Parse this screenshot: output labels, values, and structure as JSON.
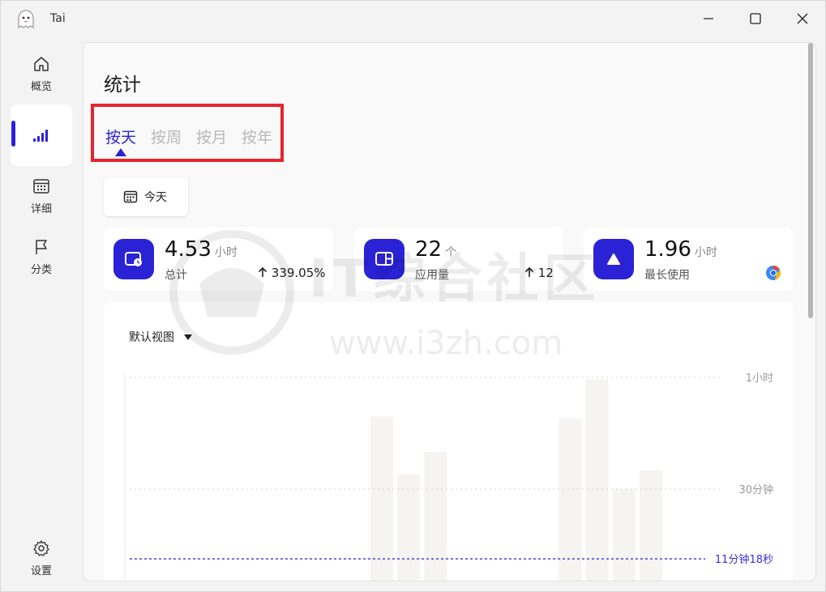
{
  "window": {
    "title": "Tai"
  },
  "sidebar": {
    "items": [
      {
        "label": "概览",
        "icon": "home-icon"
      },
      {
        "label": "",
        "icon": "signal-bars-icon"
      },
      {
        "label": "详细",
        "icon": "calendar-grid-icon"
      },
      {
        "label": "分类",
        "icon": "flag-icon"
      },
      {
        "label": "设置",
        "icon": "gear-icon"
      }
    ]
  },
  "main": {
    "title": "统计",
    "tabs": [
      {
        "label": "按天",
        "active": true
      },
      {
        "label": "按周",
        "active": false
      },
      {
        "label": "按月",
        "active": false
      },
      {
        "label": "按年",
        "active": false
      }
    ],
    "date_button": {
      "label": "今天",
      "icon": "calendar-icon"
    },
    "cards": [
      {
        "value": "4.53",
        "unit": "小时",
        "label": "总计",
        "trend": "339.05%",
        "icon": "clock-window-icon"
      },
      {
        "value": "22",
        "unit": "个",
        "label": "应用量",
        "trend": "12",
        "icon": "app-window-icon"
      },
      {
        "value": "1.96",
        "unit": "小时",
        "label": "最长使用",
        "trend": "",
        "icon": "triangle-icon"
      }
    ],
    "view_select": "默认视图"
  },
  "watermark": {
    "line1": "IT综合社区",
    "line2": "www.i3zh.com"
  },
  "chart_data": {
    "type": "bar",
    "title": "",
    "ylabel": "",
    "xlabel": "",
    "y_ticks": [
      {
        "label": "1小时",
        "minutes": 60
      },
      {
        "label": "30分钟",
        "minutes": 30
      }
    ],
    "average_line": {
      "label": "11分钟18秒",
      "minutes": 11.3
    },
    "ylim": [
      0,
      60
    ],
    "series": [
      {
        "values": [
          0,
          0,
          0,
          0,
          0,
          0,
          0,
          0,
          0,
          0,
          0,
          0,
          0,
          0,
          49.5,
          34,
          40,
          0,
          0,
          0,
          49,
          59.5,
          30,
          35
        ]
      }
    ],
    "colors": {
      "bar": "#f5f4f0",
      "grid": "#d0d0d0",
      "average": "#3a31d8",
      "tick": "#999999"
    },
    "grid": true
  },
  "colors": {
    "accent": "#2b22d6",
    "highlight_box": "#e8232f"
  }
}
